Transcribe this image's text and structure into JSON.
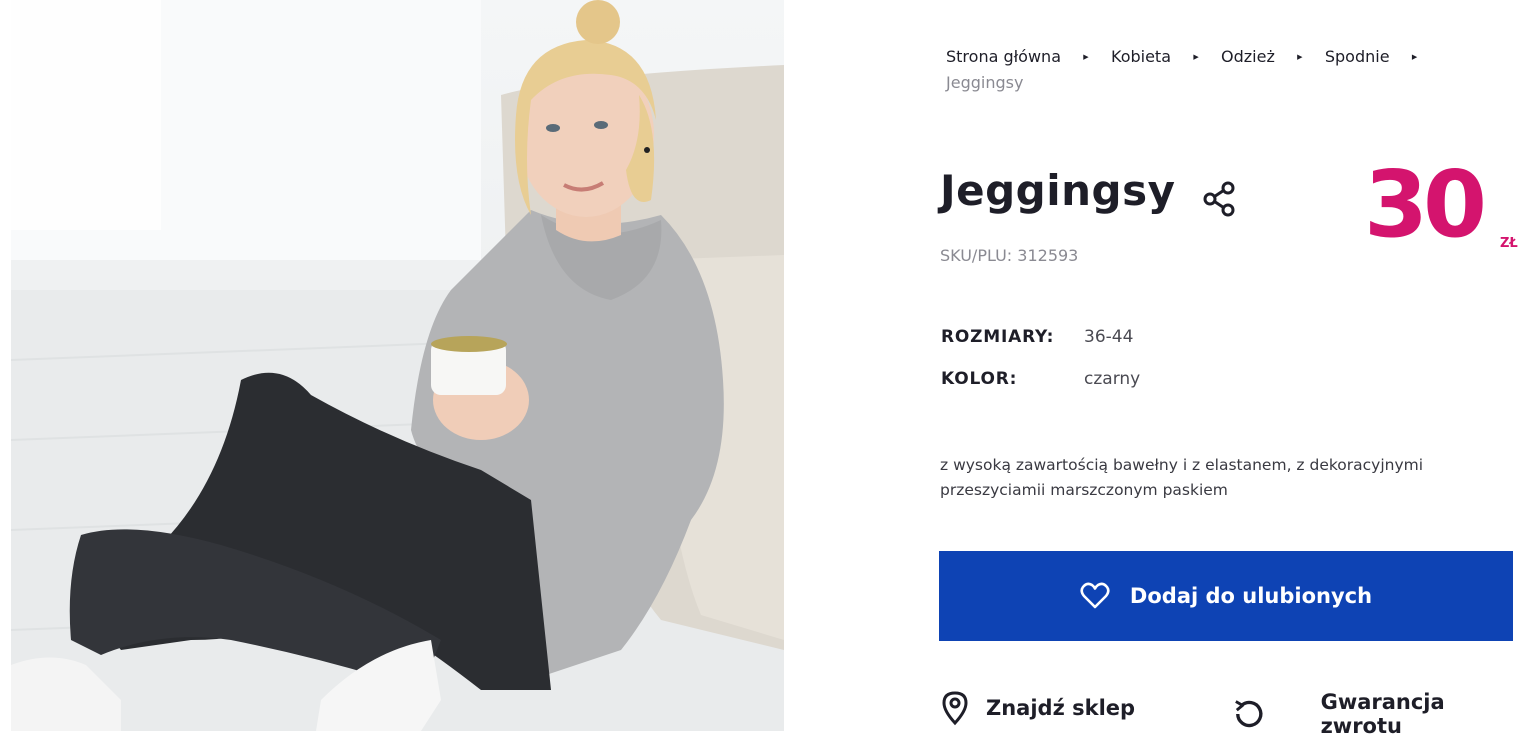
{
  "breadcrumb": {
    "items": [
      "Strona główna",
      "Kobieta",
      "Odzież",
      "Spodnie"
    ],
    "current": "Jeggingsy"
  },
  "product": {
    "title": "Jeggingsy",
    "sku": "SKU/PLU: 312593",
    "price": "30",
    "currency": "ZŁ",
    "share_icon": "share-icon"
  },
  "specs": {
    "sizes_label": "ROZMIARY:",
    "sizes_value": "36-44",
    "color_label": "KOLOR:",
    "color_value": "czarny"
  },
  "description": {
    "line1": "z wysoką zawartością bawełny i z elastanem, z dekoracyjnymi",
    "line2": "przeszyciamii marszczonym paskiem"
  },
  "actions": {
    "favorite_label": "Dodaj do ulubionych",
    "find_store_label": "Znajdź sklep",
    "return_label": "Gwarancja zwrotu"
  },
  "colors": {
    "accent_blue": "#0e43b4",
    "price_pink": "#d4146e",
    "text_dark": "#1e1e28",
    "text_muted": "#8a8a92"
  }
}
